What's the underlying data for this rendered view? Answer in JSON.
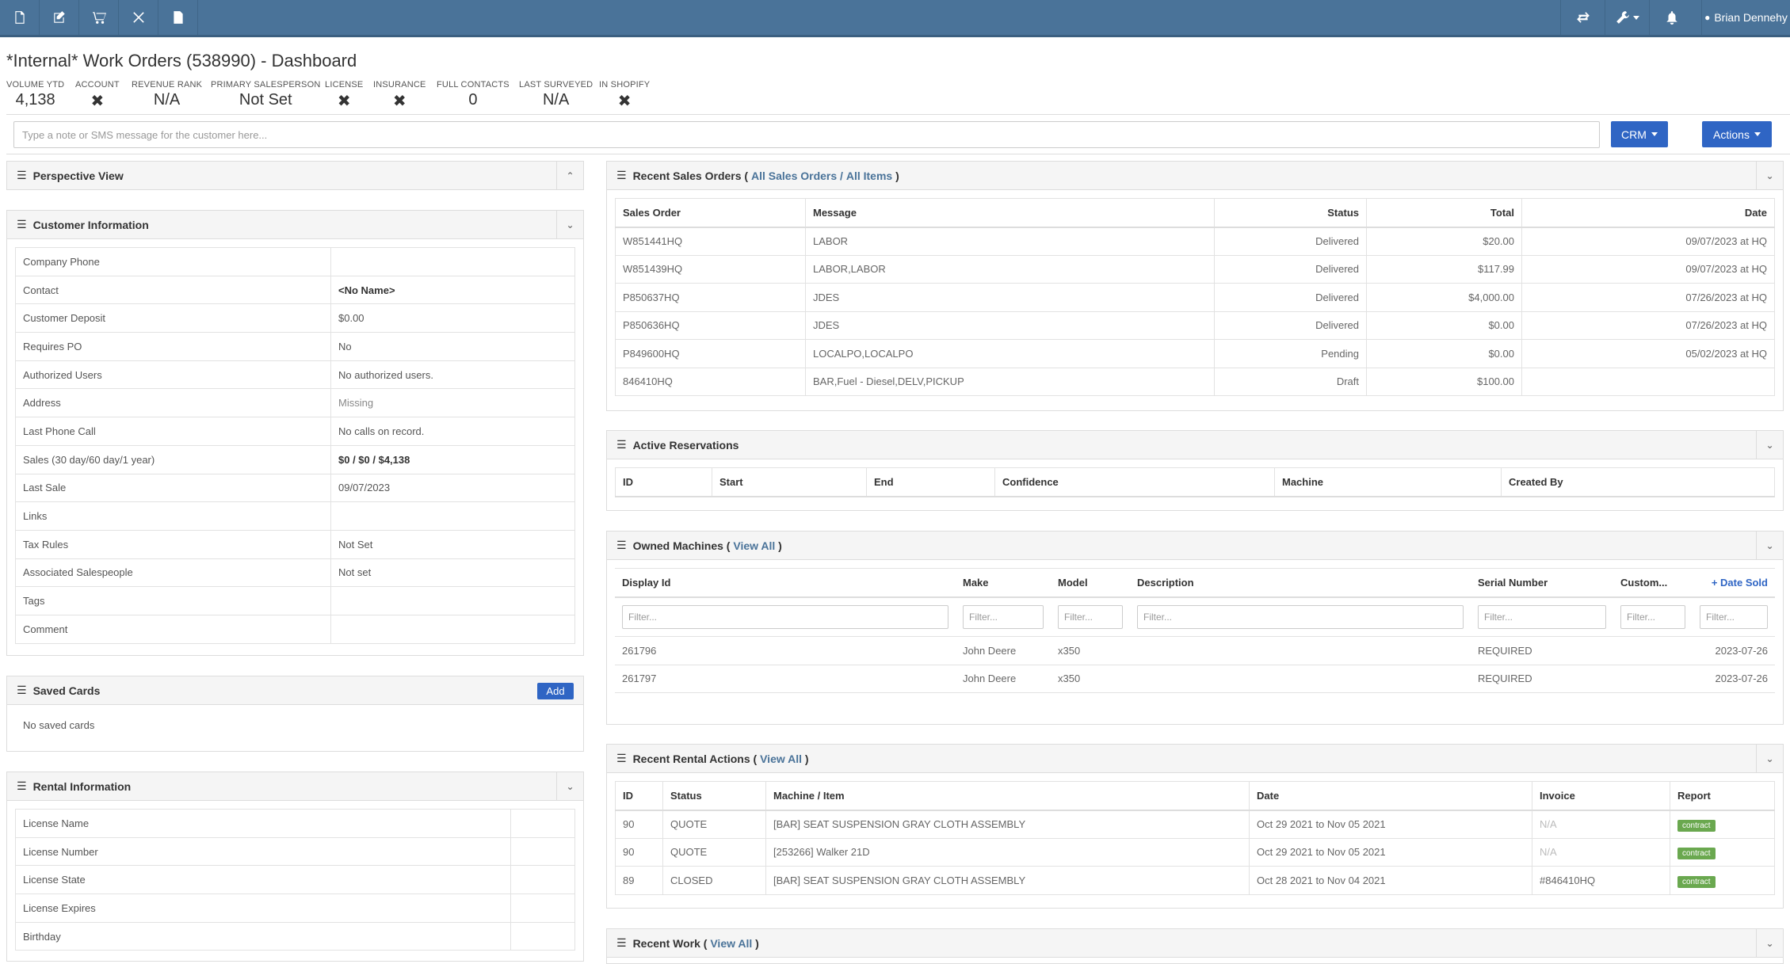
{
  "topbar": {
    "left_icons": [
      "document-icon",
      "edit-icon",
      "cart-icon",
      "tools-icon",
      "file-icon"
    ],
    "right_icons": [
      "swap-icon",
      "wrench-icon",
      "bell-icon"
    ],
    "user_name": "Brian Dennehy"
  },
  "page": {
    "title": "*Internal* Work Orders (538990) - Dashboard"
  },
  "stats": [
    {
      "label": "VOLUME YTD",
      "value": "4,138"
    },
    {
      "label": "ACCOUNT",
      "value": "✖"
    },
    {
      "label": "REVENUE RANK",
      "value": "N/A"
    },
    {
      "label": "PRIMARY SALESPERSON",
      "value": "Not Set"
    },
    {
      "label": "LICENSE",
      "value": "✖"
    },
    {
      "label": "INSURANCE",
      "value": "✖"
    },
    {
      "label": "FULL CONTACTS",
      "value": "0"
    },
    {
      "label": "LAST SURVEYED",
      "value": "N/A"
    },
    {
      "label": "IN SHOPIFY",
      "value": "✖"
    }
  ],
  "note": {
    "placeholder": "Type a note or SMS message for the customer here..."
  },
  "buttons": {
    "crm": "CRM",
    "actions": "Actions",
    "add": "Add"
  },
  "panels": {
    "perspective": "Perspective View",
    "customer_info": "Customer Information",
    "saved_cards": "Saved Cards",
    "rental_info": "Rental Information",
    "recent_sales": "Recent Sales Orders",
    "recent_sales_links": [
      "All Sales Orders",
      "All Items"
    ],
    "active_reservations": "Active Reservations",
    "owned_machines": "Owned Machines",
    "view_all": "View All",
    "recent_rental": "Recent Rental Actions",
    "recent_work": "Recent Work"
  },
  "customer_info": {
    "rows": [
      {
        "key": "Company Phone",
        "value": ""
      },
      {
        "key": "Contact",
        "value": "<No Name>"
      },
      {
        "key": "Customer Deposit",
        "value": "$0.00"
      },
      {
        "key": "Requires PO",
        "value": "No"
      },
      {
        "key": "Authorized Users",
        "value": "No authorized users."
      },
      {
        "key": "Address",
        "value": "Missing"
      },
      {
        "key": "Last Phone Call",
        "value": "No calls on record."
      },
      {
        "key": "Sales (30 day/60 day/1 year)",
        "value": "$0 / $0 / $4,138"
      },
      {
        "key": "Last Sale",
        "value": "09/07/2023"
      },
      {
        "key": "Links",
        "value": ""
      },
      {
        "key": "Tax Rules",
        "value": "Not Set"
      },
      {
        "key": "Associated Salespeople",
        "value": "Not set"
      },
      {
        "key": "Tags",
        "value": ""
      },
      {
        "key": "Comment",
        "value": ""
      }
    ]
  },
  "saved_cards": {
    "empty": "No saved cards"
  },
  "rental_info": {
    "rows": [
      "License Name",
      "License Number",
      "License State",
      "License Expires",
      "Birthday"
    ]
  },
  "sales_orders": {
    "headers": [
      "Sales Order",
      "Message",
      "Status",
      "Total",
      "Date"
    ],
    "rows": [
      [
        "W851441HQ",
        "LABOR",
        "Delivered",
        "$20.00",
        "09/07/2023 at HQ"
      ],
      [
        "W851439HQ",
        "LABOR,LABOR",
        "Delivered",
        "$117.99",
        "09/07/2023 at HQ"
      ],
      [
        "P850637HQ",
        "JDES",
        "Delivered",
        "$4,000.00",
        "07/26/2023 at HQ"
      ],
      [
        "P850636HQ",
        "JDES",
        "Delivered",
        "$0.00",
        "07/26/2023 at HQ"
      ],
      [
        "P849600HQ",
        "LOCALPO,LOCALPO",
        "Pending",
        "$0.00",
        "05/02/2023 at HQ"
      ],
      [
        "846410HQ",
        "BAR,Fuel - Diesel,DELV,PICKUP",
        "Draft",
        "$100.00",
        ""
      ]
    ]
  },
  "reservations": {
    "headers": [
      "ID",
      "Start",
      "End",
      "Confidence",
      "Machine",
      "Created By"
    ]
  },
  "machines": {
    "headers": [
      "Display Id",
      "Make",
      "Model",
      "Description",
      "Serial Number",
      "Custom...",
      "Date Sold"
    ],
    "filter_placeholder": "Filter...",
    "rows": [
      [
        "261796",
        "John Deere",
        "x350",
        "",
        "REQUIRED",
        "",
        "2023-07-26"
      ],
      [
        "261797",
        "John Deere",
        "x350",
        "",
        "REQUIRED",
        "",
        "2023-07-26"
      ]
    ]
  },
  "rentals": {
    "headers": [
      "ID",
      "Status",
      "Machine / Item",
      "Date",
      "Invoice",
      "Report"
    ],
    "rows": [
      [
        "90",
        "QUOTE",
        "[BAR] SEAT SUSPENSION GRAY CLOTH ASSEMBLY",
        "Oct 29 2021 to Nov 05 2021",
        "N/A",
        "contract"
      ],
      [
        "90",
        "QUOTE",
        "[253266] Walker 21D",
        "Oct 29 2021 to Nov 05 2021",
        "N/A",
        "contract"
      ],
      [
        "89",
        "CLOSED",
        "[BAR] SEAT SUSPENSION GRAY CLOTH ASSEMBLY",
        "Oct 28 2021 to Nov 04 2021",
        "#846410HQ",
        "contract"
      ]
    ]
  }
}
